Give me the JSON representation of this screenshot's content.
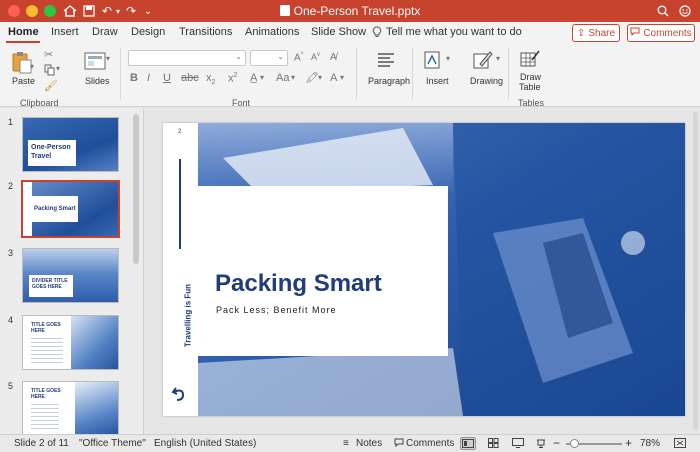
{
  "app": {
    "document_title": "One-Person Travel.pptx"
  },
  "tabs": [
    "Home",
    "Insert",
    "Draw",
    "Design",
    "Transitions",
    "Animations",
    "Slide Show"
  ],
  "tell_me": "Tell me what you want to do",
  "share_label": "Share",
  "comments_label": "Comments",
  "ribbon": {
    "paste": "Paste",
    "slides": "Slides",
    "paragraph": "Paragraph",
    "insert": "Insert",
    "drawing": "Drawing",
    "draw_table_1": "Draw",
    "draw_table_2": "Table",
    "group_clipboard": "Clipboard",
    "group_font": "Font",
    "group_tables": "Tables"
  },
  "thumbnails": [
    {
      "num": "1",
      "title": "One-Person Travel"
    },
    {
      "num": "2",
      "title": "Packing Smart"
    },
    {
      "num": "3",
      "title": "DIVIDER TITLE GOES HERE"
    },
    {
      "num": "4",
      "title": "TITLE GOES HERE"
    },
    {
      "num": "5",
      "title": "TITLE GOES HERE"
    }
  ],
  "slide": {
    "page_number": "2",
    "vertical_text": "Travelling is Fun",
    "title": "Packing Smart",
    "subtitle": "Pack Less; Benefit More"
  },
  "status": {
    "slide_of": "Slide 2 of 11",
    "theme": "\"Office Theme\"",
    "language": "English (United States)",
    "notes": "Notes",
    "comments": "Comments",
    "zoom": "78%"
  },
  "colors": {
    "accent": "#c8432e",
    "slide_blue": "#1f4e9a",
    "title_navy": "#1f3d7a"
  },
  "icons": [
    "home-icon",
    "save-icon",
    "undo-icon",
    "redo-icon",
    "search-icon",
    "smiley-icon",
    "share-icon",
    "comment-icon",
    "lightbulb-icon"
  ]
}
